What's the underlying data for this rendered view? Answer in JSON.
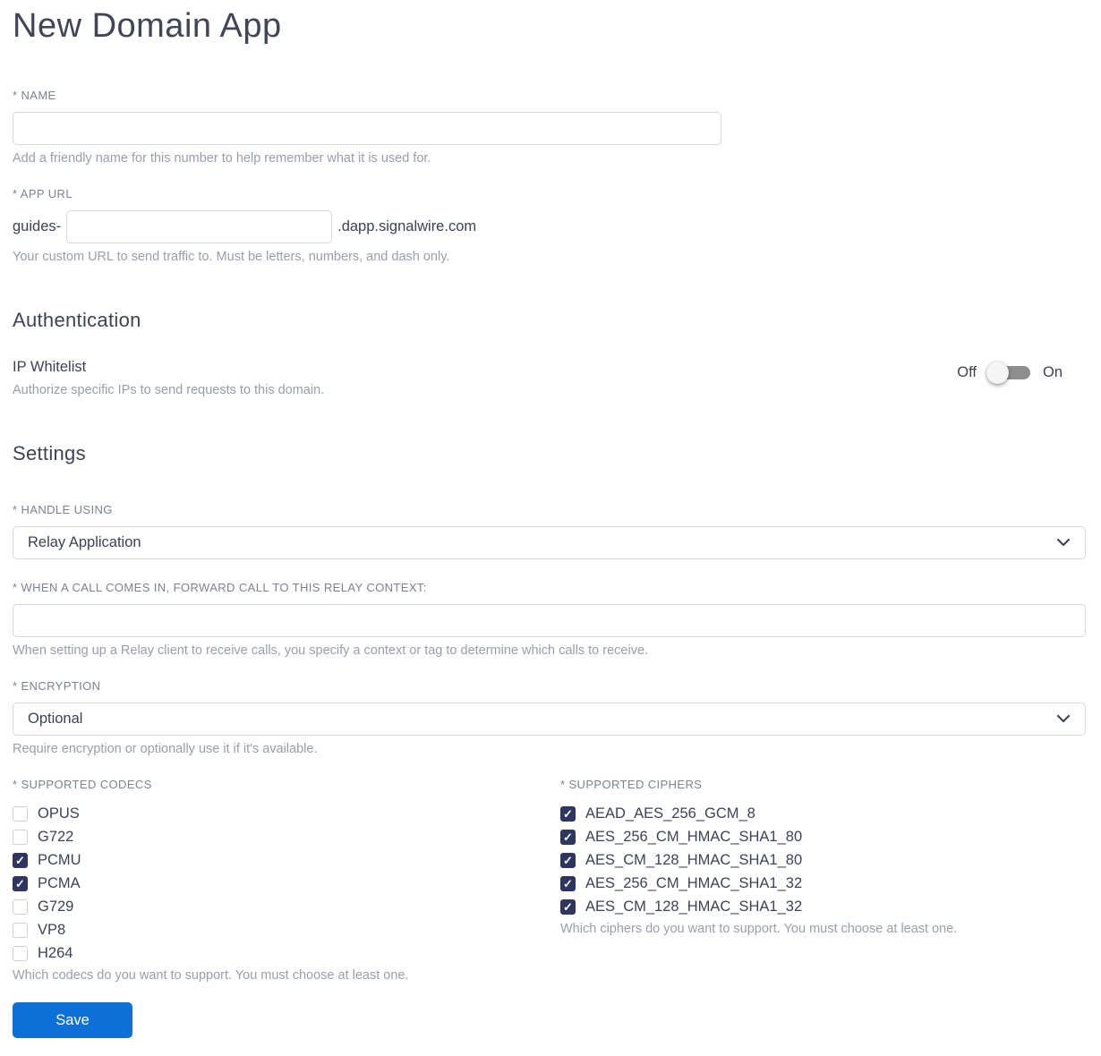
{
  "page": {
    "title": "New Domain App"
  },
  "colors": {
    "accent_blue": "#0d6fd8",
    "checkbox_checked": "#2e3560",
    "border": "#d5d9e0",
    "label_gray": "#7d828f",
    "helper_gray": "#999ea9",
    "text_dark": "#3d4254",
    "toggle_track": "#8e8e8e"
  },
  "fields": {
    "name": {
      "label": "* NAME",
      "value": "",
      "helper": "Add a friendly name for this number to help remember what it is used for."
    },
    "app_url": {
      "label": "* APP URL",
      "prefix": "guides-",
      "value": "",
      "suffix": ".dapp.signalwire.com",
      "helper": "Your custom URL to send traffic to. Must be letters, numbers, and dash only."
    }
  },
  "authentication": {
    "heading": "Authentication",
    "ip_whitelist": {
      "label": "IP Whitelist",
      "helper": "Authorize specific IPs to send requests to this domain.",
      "off_label": "Off",
      "on_label": "On",
      "state": "off"
    }
  },
  "settings": {
    "heading": "Settings",
    "handle_using": {
      "label": "* HANDLE USING",
      "value": "Relay Application"
    },
    "relay_context": {
      "label": "* WHEN A CALL COMES IN, FORWARD CALL TO THIS RELAY CONTEXT:",
      "value": "",
      "helper": "When setting up a Relay client to receive calls, you specify a context or tag to determine which calls to receive."
    },
    "encryption": {
      "label": "* ENCRYPTION",
      "value": "Optional",
      "helper": "Require encryption or optionally use it if it's available."
    },
    "codecs": {
      "label": "* SUPPORTED CODECS",
      "helper": "Which codecs do you want to support. You must choose at least one.",
      "items": [
        {
          "label": "OPUS",
          "checked": false
        },
        {
          "label": "G722",
          "checked": false
        },
        {
          "label": "PCMU",
          "checked": true
        },
        {
          "label": "PCMA",
          "checked": true
        },
        {
          "label": "G729",
          "checked": false
        },
        {
          "label": "VP8",
          "checked": false
        },
        {
          "label": "H264",
          "checked": false
        }
      ]
    },
    "ciphers": {
      "label": "* SUPPORTED CIPHERS",
      "helper": "Which ciphers do you want to support. You must choose at least one.",
      "items": [
        {
          "label": "AEAD_AES_256_GCM_8",
          "checked": true
        },
        {
          "label": "AES_256_CM_HMAC_SHA1_80",
          "checked": true
        },
        {
          "label": "AES_CM_128_HMAC_SHA1_80",
          "checked": true
        },
        {
          "label": "AES_256_CM_HMAC_SHA1_32",
          "checked": true
        },
        {
          "label": "AES_CM_128_HMAC_SHA1_32",
          "checked": true
        }
      ]
    }
  },
  "actions": {
    "save_label": "Save"
  }
}
